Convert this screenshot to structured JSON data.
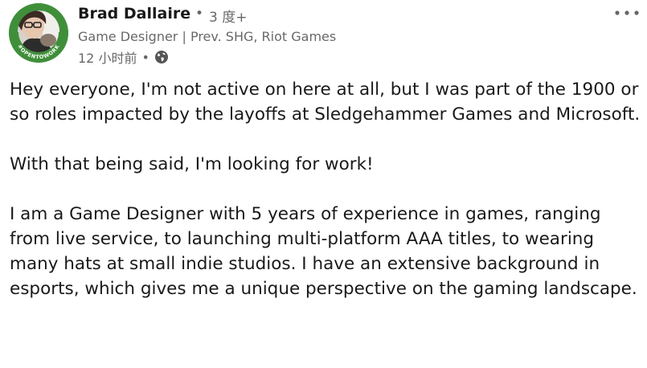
{
  "post": {
    "actor": {
      "name": "Brad Dallaire",
      "separator": "•",
      "degree": "3 度+",
      "headline": "Game Designer | Prev. SHG, Riot Games",
      "timestamp": "12 小时前",
      "meta_separator": "•",
      "visibility_icon": "globe-icon",
      "avatar_badge_text": "#OPENTOWORK"
    },
    "menu_icon": "more-horizontal-icon",
    "commentary": {
      "paragraphs": [
        "Hey everyone, I'm not active on here at all, but I was part of the 1900 or so roles impacted by the layoffs at Sledgehammer Games and Microsoft.",
        "With that being said, I'm looking for work!",
        "I am a Game Designer with 5 years of experience in games, ranging from live service, to launching multi-platform AAA titles, to wearing many hats at small indie studios. I have an extensive background in esports, which gives me a unique perspective on the gaming landscape."
      ]
    },
    "colors": {
      "open_to_work_green": "#3f8f3a",
      "primary_text": "#191919",
      "secondary_text": "#666666"
    }
  }
}
